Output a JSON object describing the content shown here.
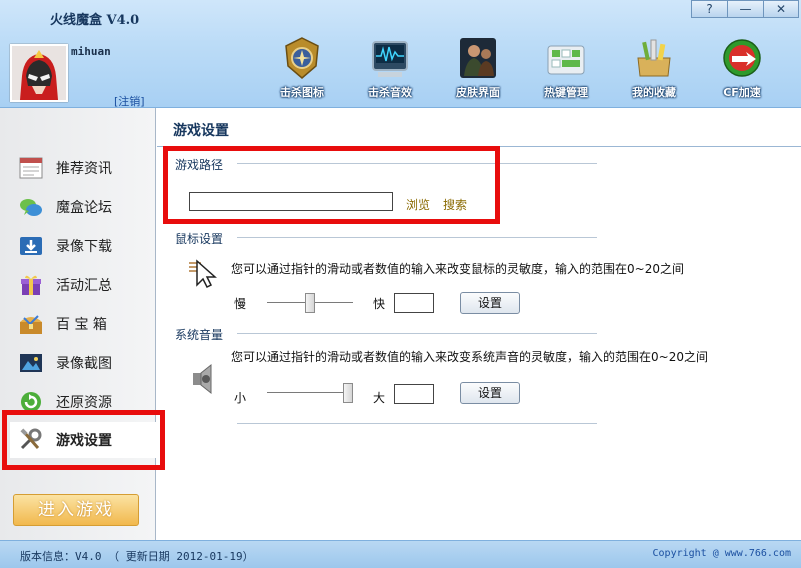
{
  "window": {
    "title": "火线魔盒 V4.0",
    "help_label": "?",
    "minimize_label": "—",
    "close_label": "✕"
  },
  "user": {
    "name": "mihuan",
    "logout_label": "[注销]"
  },
  "toolbar": [
    {
      "label": "击杀图标",
      "icon": "kill-icon"
    },
    {
      "label": "击杀音效",
      "icon": "sound-effect-icon"
    },
    {
      "label": "皮肤界面",
      "icon": "skin-icon"
    },
    {
      "label": "热键管理",
      "icon": "hotkey-icon"
    },
    {
      "label": "我的收藏",
      "icon": "favorites-icon"
    },
    {
      "label": "CF加速",
      "icon": "cf-accelerate-icon"
    }
  ],
  "sidebar": {
    "items": [
      {
        "label": "推荐资讯",
        "icon": "calendar-news-icon"
      },
      {
        "label": "魔盒论坛",
        "icon": "forum-chat-icon"
      },
      {
        "label": "录像下载",
        "icon": "download-icon"
      },
      {
        "label": "活动汇总",
        "icon": "gift-icon"
      },
      {
        "label": "百 宝 箱",
        "icon": "treasure-box-icon"
      },
      {
        "label": "录像截图",
        "icon": "screenshot-icon"
      },
      {
        "label": "还原资源",
        "icon": "restore-icon"
      },
      {
        "label": "游戏设置",
        "icon": "tools-icon",
        "active": true
      }
    ],
    "enter_game_label": "进入游戏"
  },
  "settings": {
    "title": "游戏设置",
    "game_path": {
      "group_label": "游戏路径",
      "value": "",
      "browse_label": "浏览",
      "search_label": "搜索"
    },
    "mouse": {
      "group_label": "鼠标设置",
      "description": "您可以通过指针的滑动或者数值的输入来改变鼠标的灵敏度，输入的范围在0~20之间",
      "min_label": "慢",
      "max_label": "快",
      "slider_level": 0.5,
      "value": "",
      "set_label": "设置"
    },
    "volume": {
      "group_label": "系统音量",
      "description": "您可以通过指针的滑动或者数值的输入来改变系统声音的灵敏度，输入的范围在0~20之间",
      "min_label": "小",
      "max_label": "大",
      "slider_level": 1.0,
      "value": "",
      "set_label": "设置"
    }
  },
  "footer": {
    "version": "版本信息：V4.0 （ 更新日期 2012-01-19）",
    "copyright": "Copyright @ www.766.com"
  },
  "colors": {
    "highlight": "#e80d0d",
    "header": "#a8d0f3",
    "title_text": "#17375e"
  }
}
